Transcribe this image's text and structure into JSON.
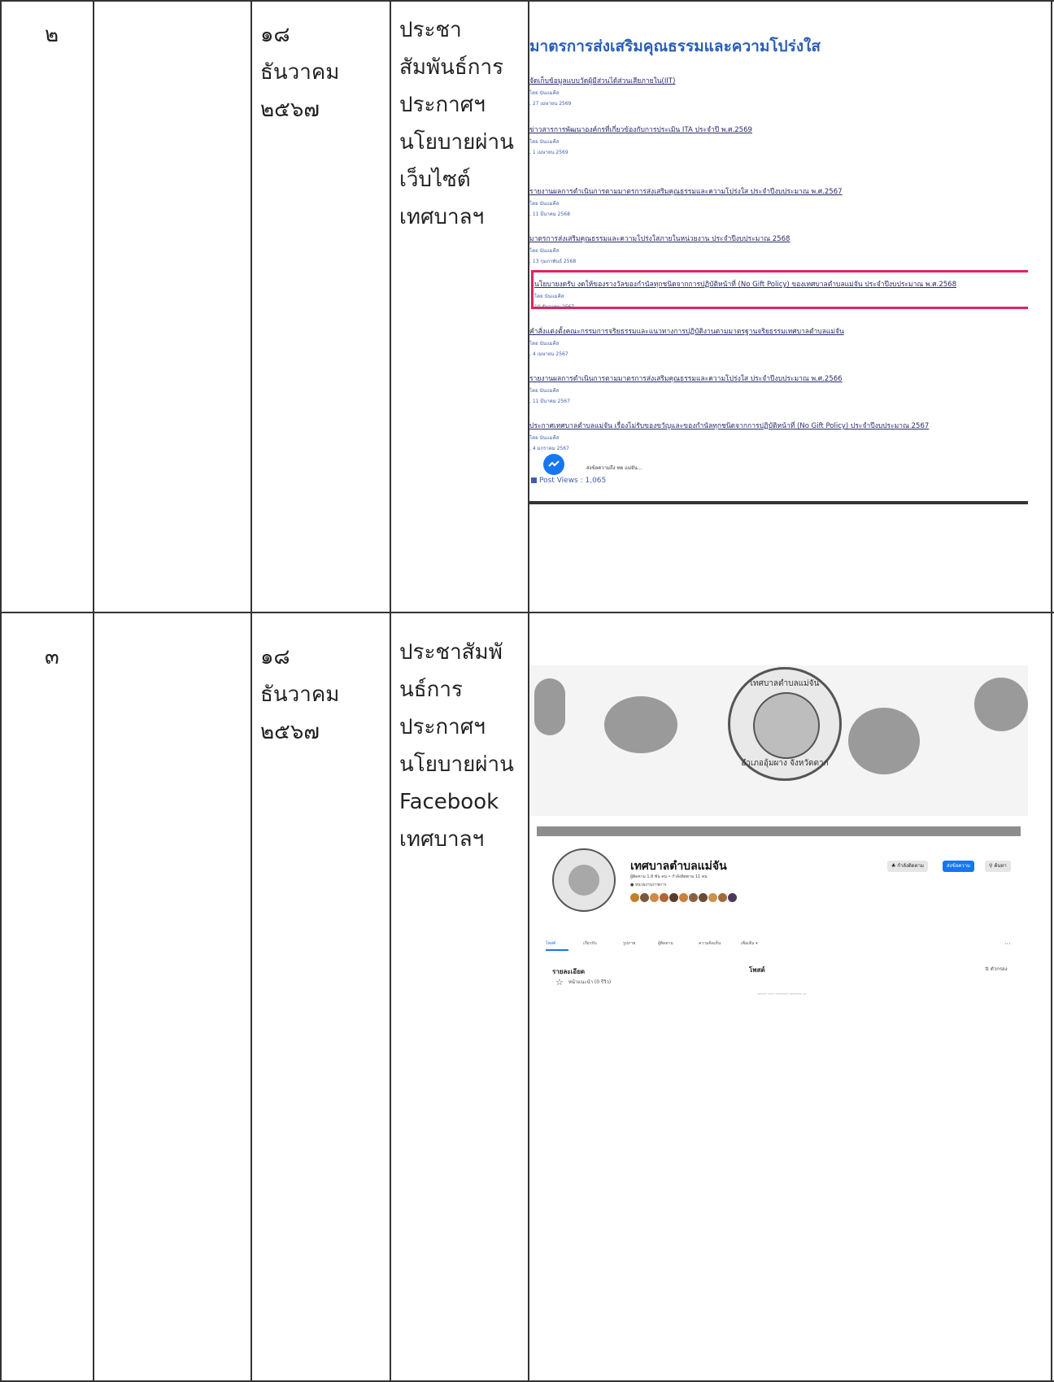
{
  "rows": [
    {
      "number": "๒",
      "date_lines": [
        "๑๘",
        "ธันวาคม",
        "๒๕๖๗"
      ],
      "topic_lines": [
        "ประชา",
        "สัมพันธ์การ",
        "ประกาศฯ",
        "นโยบายผ่าน",
        "เว็บไซต์",
        "เทศบาลฯ"
      ]
    },
    {
      "number": "๓",
      "date_lines": [
        "๑๘",
        "ธันวาคม",
        "๒๕๖๗"
      ],
      "topic_lines": [
        "ประชาสัมพั",
        "นธ์การ",
        "ประกาศฯ",
        "นโยบายผ่าน",
        "Facebook",
        "เทศบาลฯ"
      ]
    }
  ],
  "website_screenshot": {
    "heading": "มาตรการส่งเสริมคุณธรรมและความโปร่งใส",
    "entries": [
      {
        "title": "จัดเก็บข้อมูลแบบวัดผู้มีส่วนได้ส่วนเสียภายใน(IIT)",
        "author": "โดย นันแมคีส",
        "date": ", 27 เมษายน 2569"
      },
      {
        "title": "ข่าวสารการพัฒนาองค์กรที่เกี่ยวข้องกับการประเมิน ITA ประจำปี พ.ศ.2569",
        "author": "โดย นันแมคีส",
        "date": ", 1 เมษายน 2569"
      },
      {
        "title": "รายงานผลการดำเนินการตามมาตรการส่งเสริมคุณธรรมและความโปร่งใส ประจำปีงบประมาณ พ.ศ.2567",
        "author": "โดย นันแมคีส",
        "date": ", 11 มีนาคม 2568"
      },
      {
        "title": "มาตรการส่งเสริมคุณธรรมและความโปร่งใสภายในหน่วยงาน ประจำปีงบประมาณ 2568",
        "author": "โดย นันแมคีส",
        "date": ", 13 กุมภาพันธ์ 2568"
      },
      {
        "title": "นโยบายงดรับ งดให้ของรางวัลของกำนัลทุกชนิดจากการปฏิบัติหน้าที่ (No Gift Policy) ของเทศบาลตำบลแม่จัน ประจำปีงบประมาณ พ.ศ.2568",
        "author": "โดย นันแมคีส",
        "date": "10 ธันวาคม 2567"
      },
      {
        "title": "คำสั่งแต่งตั้งคณะกรรมการจริยธรรมและแนวทางการปฏิบัติงานตามมาตรฐานจริยธรรมเทศบาลตำบลแม่จัน",
        "author": "โดย นันแมคีส",
        "date": ", 4 เมษายน 2567"
      },
      {
        "title": "รายงานผลการดำเนินการตามมาตรการส่งเสริมคุณธรรมและความโปร่งใส ประจำปีงบประมาณ พ.ศ.2566",
        "author": "โดย นันแมคีส",
        "date": ", 11 มีนาคม 2567"
      },
      {
        "title": "ประกาศเทศบาลตำบลแม่จัน เรื่องไม่รับของขวัญและของกำนัลทุกชนิดจากการปฏิบัติหน้าที่ (No Gift Policy) ประจำปีงบประมาณ 2567",
        "author": "โดย นันแมคีส",
        "date": ", 4 มกราคม 2567"
      }
    ],
    "messenger_text": "ส่งข้อความถึง ทต แม่จัน...",
    "post_views": "Post Views : 1,065"
  },
  "facebook_screenshot": {
    "cover_seal_top": "เทศบาลตำบลแม่จัน",
    "cover_seal_bottom": "อำเภออุ้มผาง จังหวัดตาก",
    "page_name": "เทศบาลตำบลแม่จัน",
    "stats": "ผู้ติดตาม 1.8 พัน คน • กำลังติดตาม 11 คน",
    "badge": "● หน่วยงานราชการ",
    "buttons": {
      "follow": "♣ กำลังติดตาม",
      "message": "ส่งข้อความ",
      "search": "ค้นหา"
    },
    "tabs": [
      "โพสต์",
      "เกี่ยวกับ",
      "รูปภาพ",
      "ผู้ติดตาม",
      "ความคิดเห็น",
      "เพิ่มเติม ▾"
    ],
    "tabs_more": "···",
    "section_left": "รายละเอียด",
    "section_mid": "โพสต์",
    "section_right": "⇅ ตัวกรอง",
    "info_row": "หน้าแนะนำ (0 รีวิว)"
  }
}
